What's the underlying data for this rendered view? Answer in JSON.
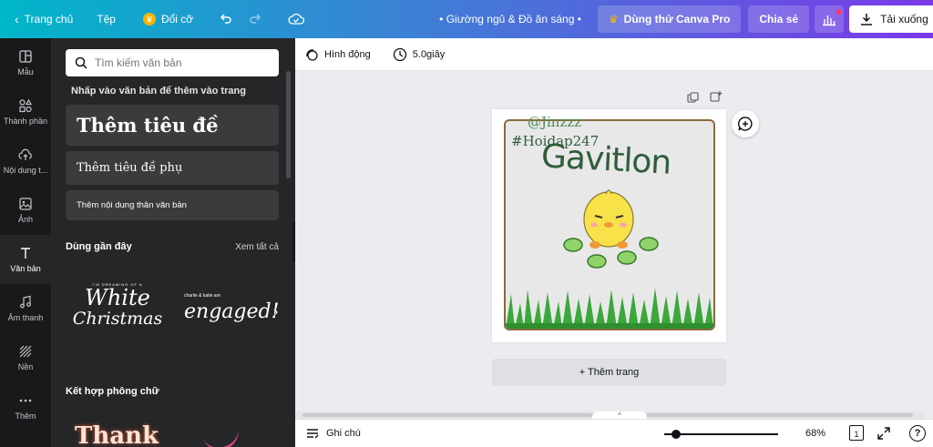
{
  "topbar": {
    "home": "Trang chủ",
    "file": "Tệp",
    "resize": "Đổi cỡ",
    "doc_title": "• Giường ngủ & Đồ ăn sáng •",
    "try_pro": "Dùng thử Canva Pro",
    "share": "Chia sẻ",
    "download": "Tải xuống"
  },
  "rail": {
    "items": [
      {
        "label": "Mẫu",
        "icon": "templates-icon"
      },
      {
        "label": "Thành phần",
        "icon": "elements-icon"
      },
      {
        "label": "Nội dung t...",
        "icon": "upload-icon"
      },
      {
        "label": "Ảnh",
        "icon": "photos-icon"
      },
      {
        "label": "Văn bản",
        "icon": "text-icon"
      },
      {
        "label": "Âm thanh",
        "icon": "audio-icon"
      },
      {
        "label": "Nền",
        "icon": "background-icon"
      },
      {
        "label": "Thêm",
        "icon": "more-icon"
      }
    ]
  },
  "panel": {
    "search_placeholder": "Tìm kiếm văn bản",
    "hint": "Nhấp vào văn bản để thêm vào trang",
    "add_heading": "Thêm tiêu đề",
    "add_subheading": "Thêm tiêu đề phụ",
    "add_body": "Thêm nội dung thân văn bản",
    "recent_title": "Dùng gần đây",
    "see_all": "Xem tất cả",
    "recent_1_small": "I'M DREAMING OF A",
    "recent_1_line1": "White",
    "recent_1_line2": "Christmas",
    "recent_2_small": "charlie & katie are",
    "recent_2_main": "engaged!",
    "combo_title": "Kết hợp phông chữ",
    "combo_1": "Thank"
  },
  "toolbar2": {
    "animate": "Hình động",
    "duration": "5.0giây"
  },
  "canvas": {
    "text1": "@Jinzzz",
    "text2": "#Hoidap247",
    "text3": "Gavitlon",
    "add_page": "+ Thêm trang"
  },
  "bottombar": {
    "notes": "Ghi chú",
    "zoom": "68%",
    "page_count": "1",
    "help": "?"
  },
  "colors": {
    "canvas_text": "#2f5d3a",
    "grass": "#3aa83a",
    "chick": "#f7e24a",
    "frame_border": "#8a6a3d"
  }
}
